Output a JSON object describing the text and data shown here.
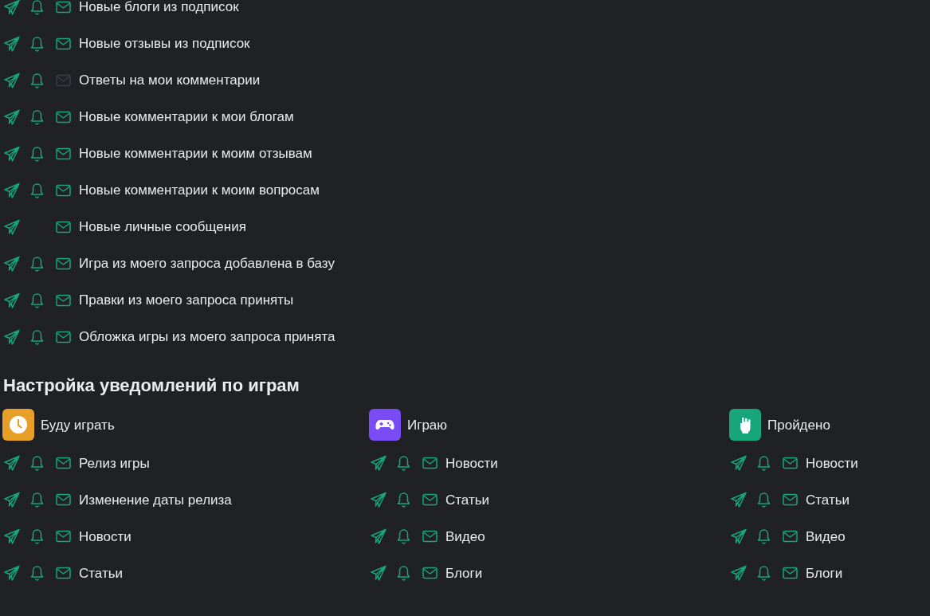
{
  "notifications": [
    {
      "label": "Новые блоги из подписок",
      "telegram": true,
      "push": true,
      "email": true
    },
    {
      "label": "Новые отзывы из подписок",
      "telegram": true,
      "push": true,
      "email": true
    },
    {
      "label": "Ответы на мои комментарии",
      "telegram": true,
      "push": true,
      "email": false
    },
    {
      "label": "Новые комментарии к мои блогам",
      "telegram": true,
      "push": true,
      "email": true
    },
    {
      "label": "Новые комментарии к моим отзывам",
      "telegram": true,
      "push": true,
      "email": true
    },
    {
      "label": "Новые комментарии к моим вопросам",
      "telegram": true,
      "push": true,
      "email": true
    },
    {
      "label": "Новые личные сообщения",
      "telegram": true,
      "email": true
    },
    {
      "label": "Игра из моего запроса добавлена в базу",
      "telegram": true,
      "push": true,
      "email": true
    },
    {
      "label": "Правки из моего запроса приняты",
      "telegram": true,
      "push": true,
      "email": true
    },
    {
      "label": "Обложка игры из моего запроса принята",
      "telegram": true,
      "push": true,
      "email": true
    }
  ],
  "games_section": {
    "title": "Настройка уведомлений по играм",
    "categories": [
      {
        "kind": "clock",
        "title": "Буду играть",
        "color": "#e89f27",
        "items": [
          {
            "label": "Релиз игры",
            "telegram": true,
            "push": true,
            "email": true
          },
          {
            "label": "Изменение даты релиза",
            "telegram": true,
            "push": true,
            "email": true
          },
          {
            "label": "Новости",
            "telegram": true,
            "push": true,
            "email": true
          },
          {
            "label": "Статьи",
            "telegram": true,
            "push": true,
            "email": true
          }
        ]
      },
      {
        "kind": "gamepad",
        "title": "Играю",
        "color": "#7b4cf5",
        "items": [
          {
            "label": "Новости",
            "telegram": true,
            "push": true,
            "email": true
          },
          {
            "label": "Статьи",
            "telegram": true,
            "push": true,
            "email": true
          },
          {
            "label": "Видео",
            "telegram": true,
            "push": true,
            "email": true
          },
          {
            "label": "Блоги",
            "telegram": true,
            "push": true,
            "email": true
          }
        ]
      },
      {
        "kind": "fist",
        "title": "Пройдено",
        "color": "#16a679",
        "items": [
          {
            "label": "Новости",
            "telegram": true,
            "push": true,
            "email": true
          },
          {
            "label": "Статьи",
            "telegram": true,
            "push": true,
            "email": true
          },
          {
            "label": "Видео",
            "telegram": true,
            "push": true,
            "email": true
          },
          {
            "label": "Блоги",
            "telegram": true,
            "push": true,
            "email": true
          }
        ]
      }
    ]
  }
}
